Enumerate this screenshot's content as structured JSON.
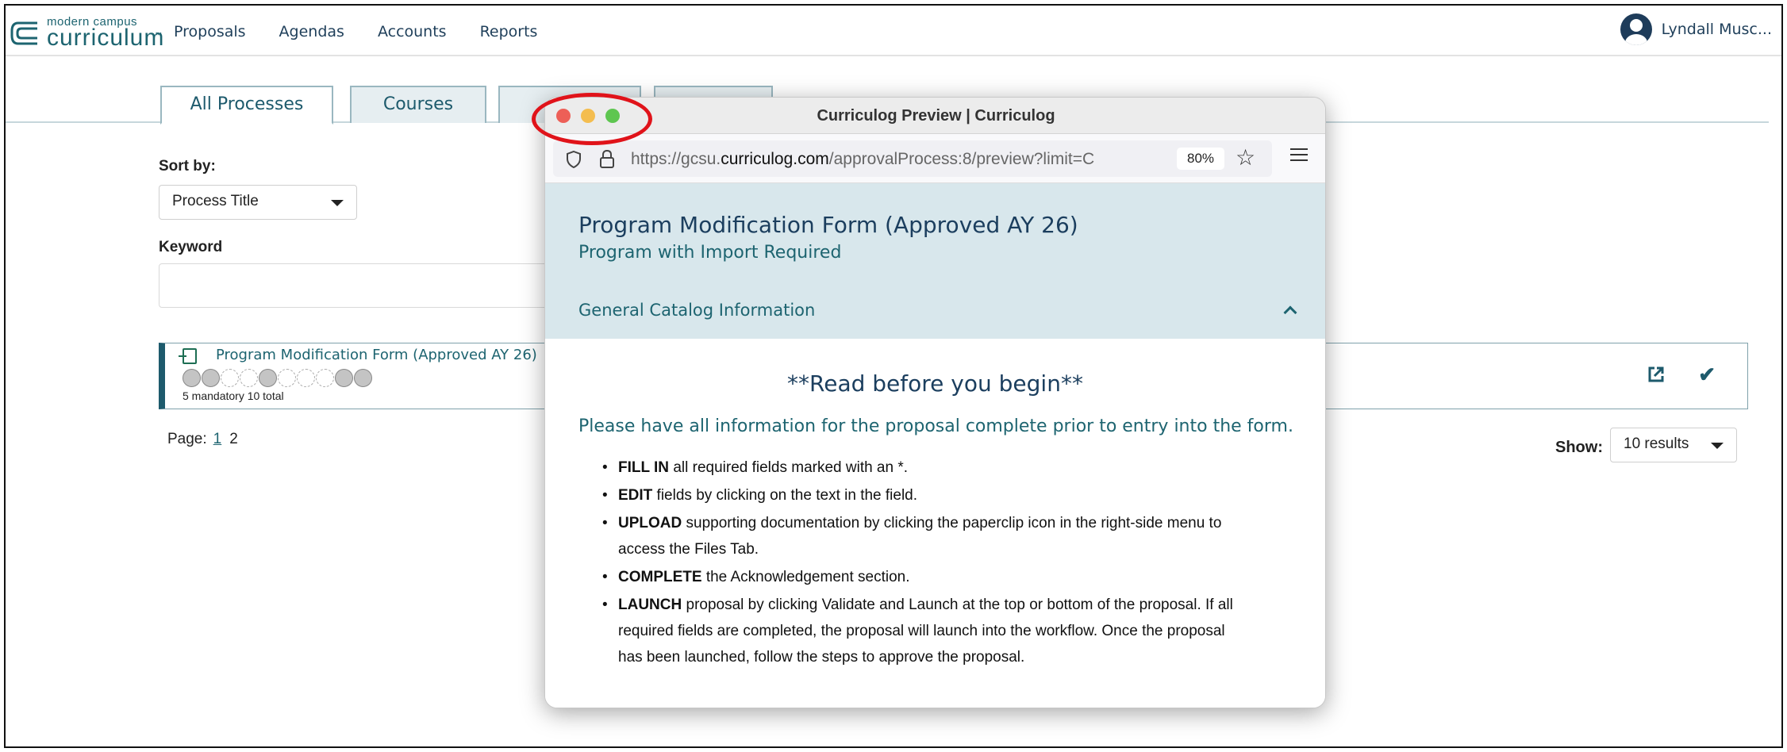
{
  "brand": {
    "small": "modern campus",
    "big": "curriculum",
    "tm": "™"
  },
  "nav": [
    "Proposals",
    "Agendas",
    "Accounts",
    "Reports"
  ],
  "user": {
    "name": "Lyndall Musc..."
  },
  "tabs": [
    "All Processes",
    "Courses",
    "",
    ""
  ],
  "sort": {
    "label": "Sort by:",
    "value": "Process Title"
  },
  "keyword": {
    "label": "Keyword",
    "value": ""
  },
  "process": {
    "title": "Program Modification Form (Approved AY 26)",
    "steps": [
      "filled",
      "filled",
      "empty",
      "empty",
      "filled",
      "empty",
      "empty",
      "empty",
      "filled",
      "filled"
    ],
    "count": "5 mandatory 10 total"
  },
  "pager": {
    "label": "Page:",
    "current": "1",
    "next": "2"
  },
  "show": {
    "label": "Show:",
    "value": "10 results"
  },
  "window": {
    "title": "Curriculog Preview | Curriculog",
    "url_prefix": "https://gcsu.",
    "url_domain": "curriculog.com",
    "url_rest": "/approvalProcess:8/preview?limit=C",
    "zoom": "80%"
  },
  "preview": {
    "title": "Program Modification Form (Approved AY 26)",
    "subtitle": "Program with Import Required",
    "section": "General Catalog Information",
    "read_title": "**Read before you begin**",
    "notice": "Please have all information for the proposal complete prior to entry into the form.",
    "items": [
      {
        "bold": "FILL IN",
        "text": " all required fields marked with an *."
      },
      {
        "bold": "EDIT",
        "text": " fields by clicking on the text in the field."
      },
      {
        "bold": "UPLOAD",
        "text": " supporting documentation by clicking the paperclip icon in the right-side menu to access the Files Tab."
      },
      {
        "bold": "COMPLETE",
        "text": " the Acknowledgement section."
      },
      {
        "bold": "LAUNCH",
        "text": " proposal by clicking Validate and Launch at the top or bottom of the proposal.  If all required fields are completed, the proposal will launch into the workflow. Once the proposal has been launched, follow the steps to approve the proposal."
      }
    ]
  }
}
